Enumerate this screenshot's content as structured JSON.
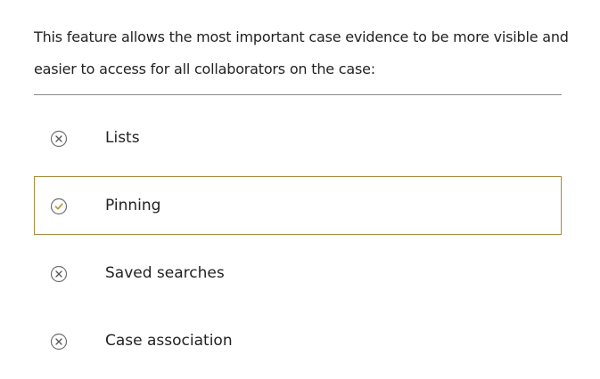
{
  "intro": {
    "line1": "This feature allows the most important case evidence to be more visible and",
    "line2": "easier to access for all collaborators on the case:"
  },
  "options": [
    {
      "label": "Lists",
      "state": "incorrect",
      "icon": "x-circle-icon"
    },
    {
      "label": "Pinning",
      "state": "correct",
      "icon": "check-circle-icon"
    },
    {
      "label": "Saved searches",
      "state": "incorrect",
      "icon": "x-circle-icon"
    },
    {
      "label": "Case association",
      "state": "incorrect",
      "icon": "x-circle-icon"
    }
  ],
  "colors": {
    "selected_border": "#a88a3c",
    "check": "#b8902c",
    "icon_gray": "#6f6f6f",
    "divider": "#8a8a8a"
  }
}
